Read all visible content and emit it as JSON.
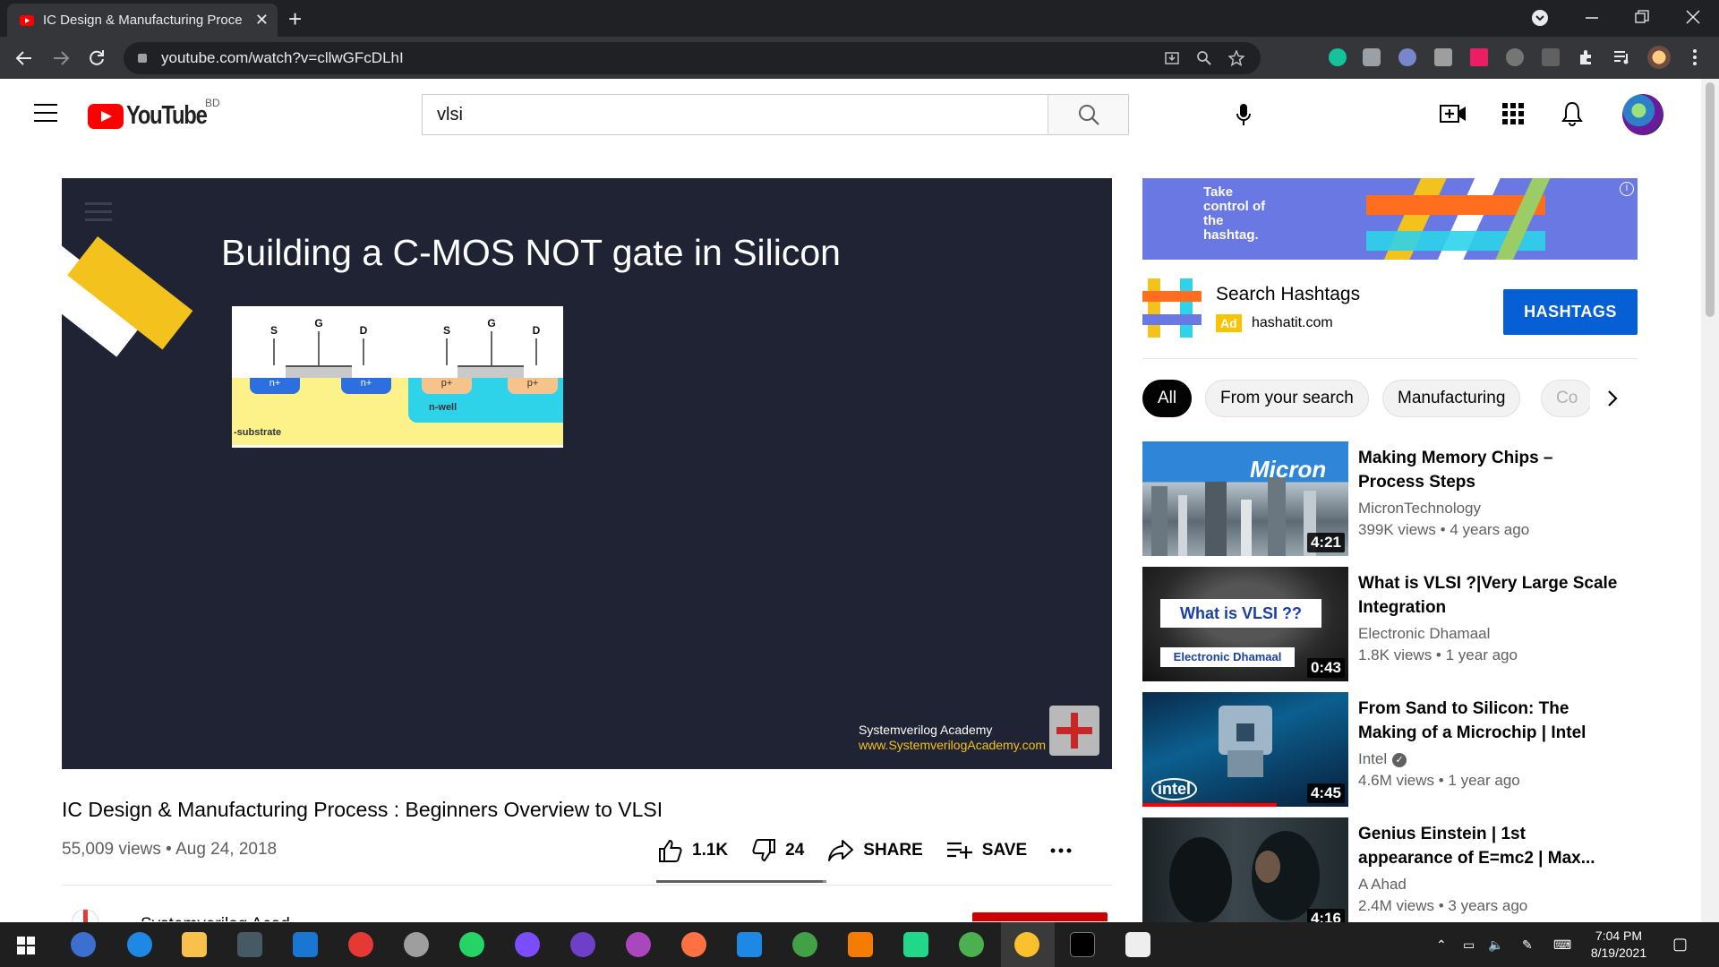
{
  "browser": {
    "tab_title": "IC Design & Manufacturing Proce",
    "new_tab": "+",
    "close_tab": "✕",
    "url": "youtube.com/watch?v=cllwGFcDLhI"
  },
  "header": {
    "logo_word": "YouTube",
    "country_code": "BD",
    "search_value": "vlsi"
  },
  "player": {
    "slide_title": "Building a C-MOS NOT gate in Silicon",
    "terminals": [
      "S",
      "G",
      "D",
      "S",
      "G",
      "D"
    ],
    "diffusion_labels": [
      "n+",
      "n+",
      "p+",
      "p+"
    ],
    "nwell_label": "n-well",
    "substrate_label": "-substrate",
    "watermark_name": "Systemverilog Academy",
    "watermark_url": "www.SystemverilogAcademy.com"
  },
  "video": {
    "title": "IC Design & Manufacturing Process : Beginners Overview to VLSI",
    "views": "55,009 views",
    "date": "Aug 24, 2018",
    "likes": "1.1K",
    "dislikes": "24",
    "share_label": "SHARE",
    "save_label": "SAVE",
    "like_ratio": 0.98,
    "channel_peek": "Systemverilog Acad..."
  },
  "ad": {
    "banner_text": "Take control of the hashtag.",
    "title": "Search Hashtags",
    "badge": "Ad",
    "domain": "hashatit.com",
    "cta": "HASHTAGS"
  },
  "chips": [
    "All",
    "From your search",
    "Manufacturing",
    "Co"
  ],
  "recommendations": [
    {
      "title": "Making Memory Chips – Process Steps",
      "channel": "MicronTechnology",
      "meta": "399K views • 4 years ago",
      "duration": "4:21",
      "thumb_text": "Micron"
    },
    {
      "title": "What is VLSI ?|Very Large Scale Integration",
      "channel": "Electronic Dhamaal",
      "meta": "1.8K views • 1 year ago",
      "duration": "0:43",
      "thumb_text": "What is VLSI ??",
      "thumb_sub": "Electronic Dhamaal"
    },
    {
      "title": "From Sand to Silicon: The Making of a Microchip | Intel",
      "channel": "Intel",
      "meta": "4.6M views • 1 year ago",
      "duration": "4:45",
      "thumb_text": "intel",
      "watched": 0.65
    },
    {
      "title": "Genius Einstein | 1st appearance of E=mc2 | Max...",
      "channel": "A Ahad",
      "meta": "2.4M views • 3 years ago",
      "duration": "4:16"
    }
  ],
  "taskbar": {
    "time": "7:04 PM",
    "date": "8/19/2021"
  }
}
